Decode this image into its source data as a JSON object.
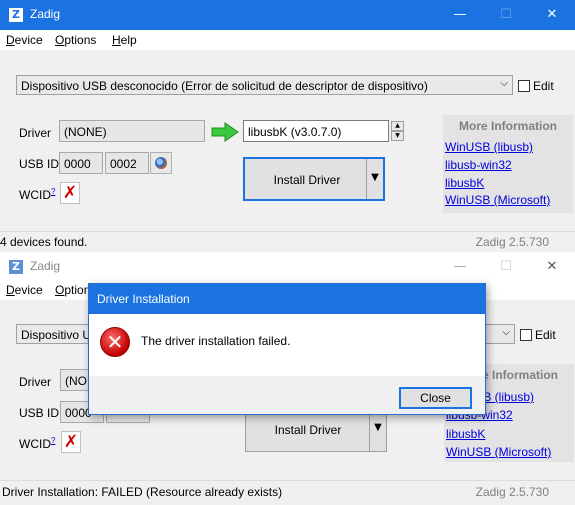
{
  "window1": {
    "title": "Zadig",
    "app_icon_glyph": "Z",
    "controls": {
      "minimize": "—",
      "maximize": "☐",
      "close": "✕"
    },
    "menu": [
      "Device",
      "Options",
      "Help"
    ],
    "device_select": "Dispositivo USB desconocido (Error de solicitud de descriptor de dispositivo)",
    "edit_label": "Edit",
    "driver_label": "Driver",
    "driver_value": "(NONE)",
    "target_driver": "libusbK (v3.0.7.0)",
    "usbid_label": "USB ID",
    "vid": "0000",
    "pid": "0002",
    "wcid_label": "WCID",
    "wcid_sup": "?",
    "install_label": "Install Driver",
    "info_title": "More Information",
    "links": [
      "WinUSB (libusb)",
      "libusb-win32",
      "libusbK",
      "WinUSB (Microsoft)"
    ],
    "status_left": "4 devices found.",
    "status_right": "Zadig 2.5.730"
  },
  "window2": {
    "title": "Zadig",
    "app_icon_glyph": "Z",
    "controls": {
      "minimize": "—",
      "maximize": "☐",
      "close": "✕"
    },
    "menu": [
      "Device",
      "Options"
    ],
    "device_select": "Dispositivo USB desconocido (Error de solicitud de descriptor de dispositivo)",
    "edit_label": "Edit",
    "driver_label": "Driver",
    "driver_value": "(NONE)",
    "usbid_label": "USB ID",
    "vid": "0000",
    "wcid_label": "WCID",
    "wcid_sup": "?",
    "install_label": "Install Driver",
    "info_title": "More Information",
    "links": [
      "WinUSB (libusb)",
      "libusb-win32",
      "libusbK",
      "WinUSB (Microsoft)"
    ],
    "status_left": "Driver Installation: FAILED (Resource already exists)",
    "status_right": "Zadig 2.5.730"
  },
  "dialog": {
    "title": "Driver Installation",
    "message": "The driver installation failed.",
    "close_button": "Close",
    "icon": "error-icon"
  },
  "colors": {
    "accent": "#1a73e0",
    "link": "#0000e0",
    "error": "#d10000",
    "arrow": "#3cc83c"
  }
}
